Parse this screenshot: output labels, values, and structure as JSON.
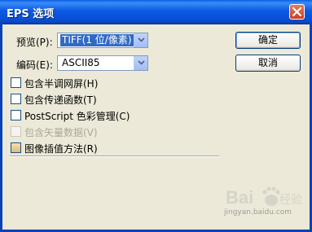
{
  "window": {
    "title": "EPS 选项"
  },
  "fields": {
    "preview_label": "预览(P):",
    "preview_value": "TIFF(1 位/像素)",
    "encoding_label": "编码(E):",
    "encoding_value": "ASCII85"
  },
  "buttons": {
    "ok": "确定",
    "cancel": "取消"
  },
  "options": [
    {
      "label": "包含半调网屏(H)",
      "checked": false,
      "enabled": true
    },
    {
      "label": "包含传递函数(T)",
      "checked": false,
      "enabled": true
    },
    {
      "label": "PostScript 色彩管理(C)",
      "checked": false,
      "enabled": true
    },
    {
      "label": "包含矢量数据(V)",
      "checked": false,
      "enabled": false
    },
    {
      "label": "图像插值方法(R)",
      "checked": true,
      "enabled": true
    }
  ],
  "watermark": {
    "logo_text": "Baidu",
    "caption": "jingyan.baidu.com"
  },
  "colors": {
    "titlebar": "#0A5FE0",
    "dialog_bg": "#ECE9D8",
    "selection": "#316AC5",
    "disabled_text": "#ACA899"
  }
}
